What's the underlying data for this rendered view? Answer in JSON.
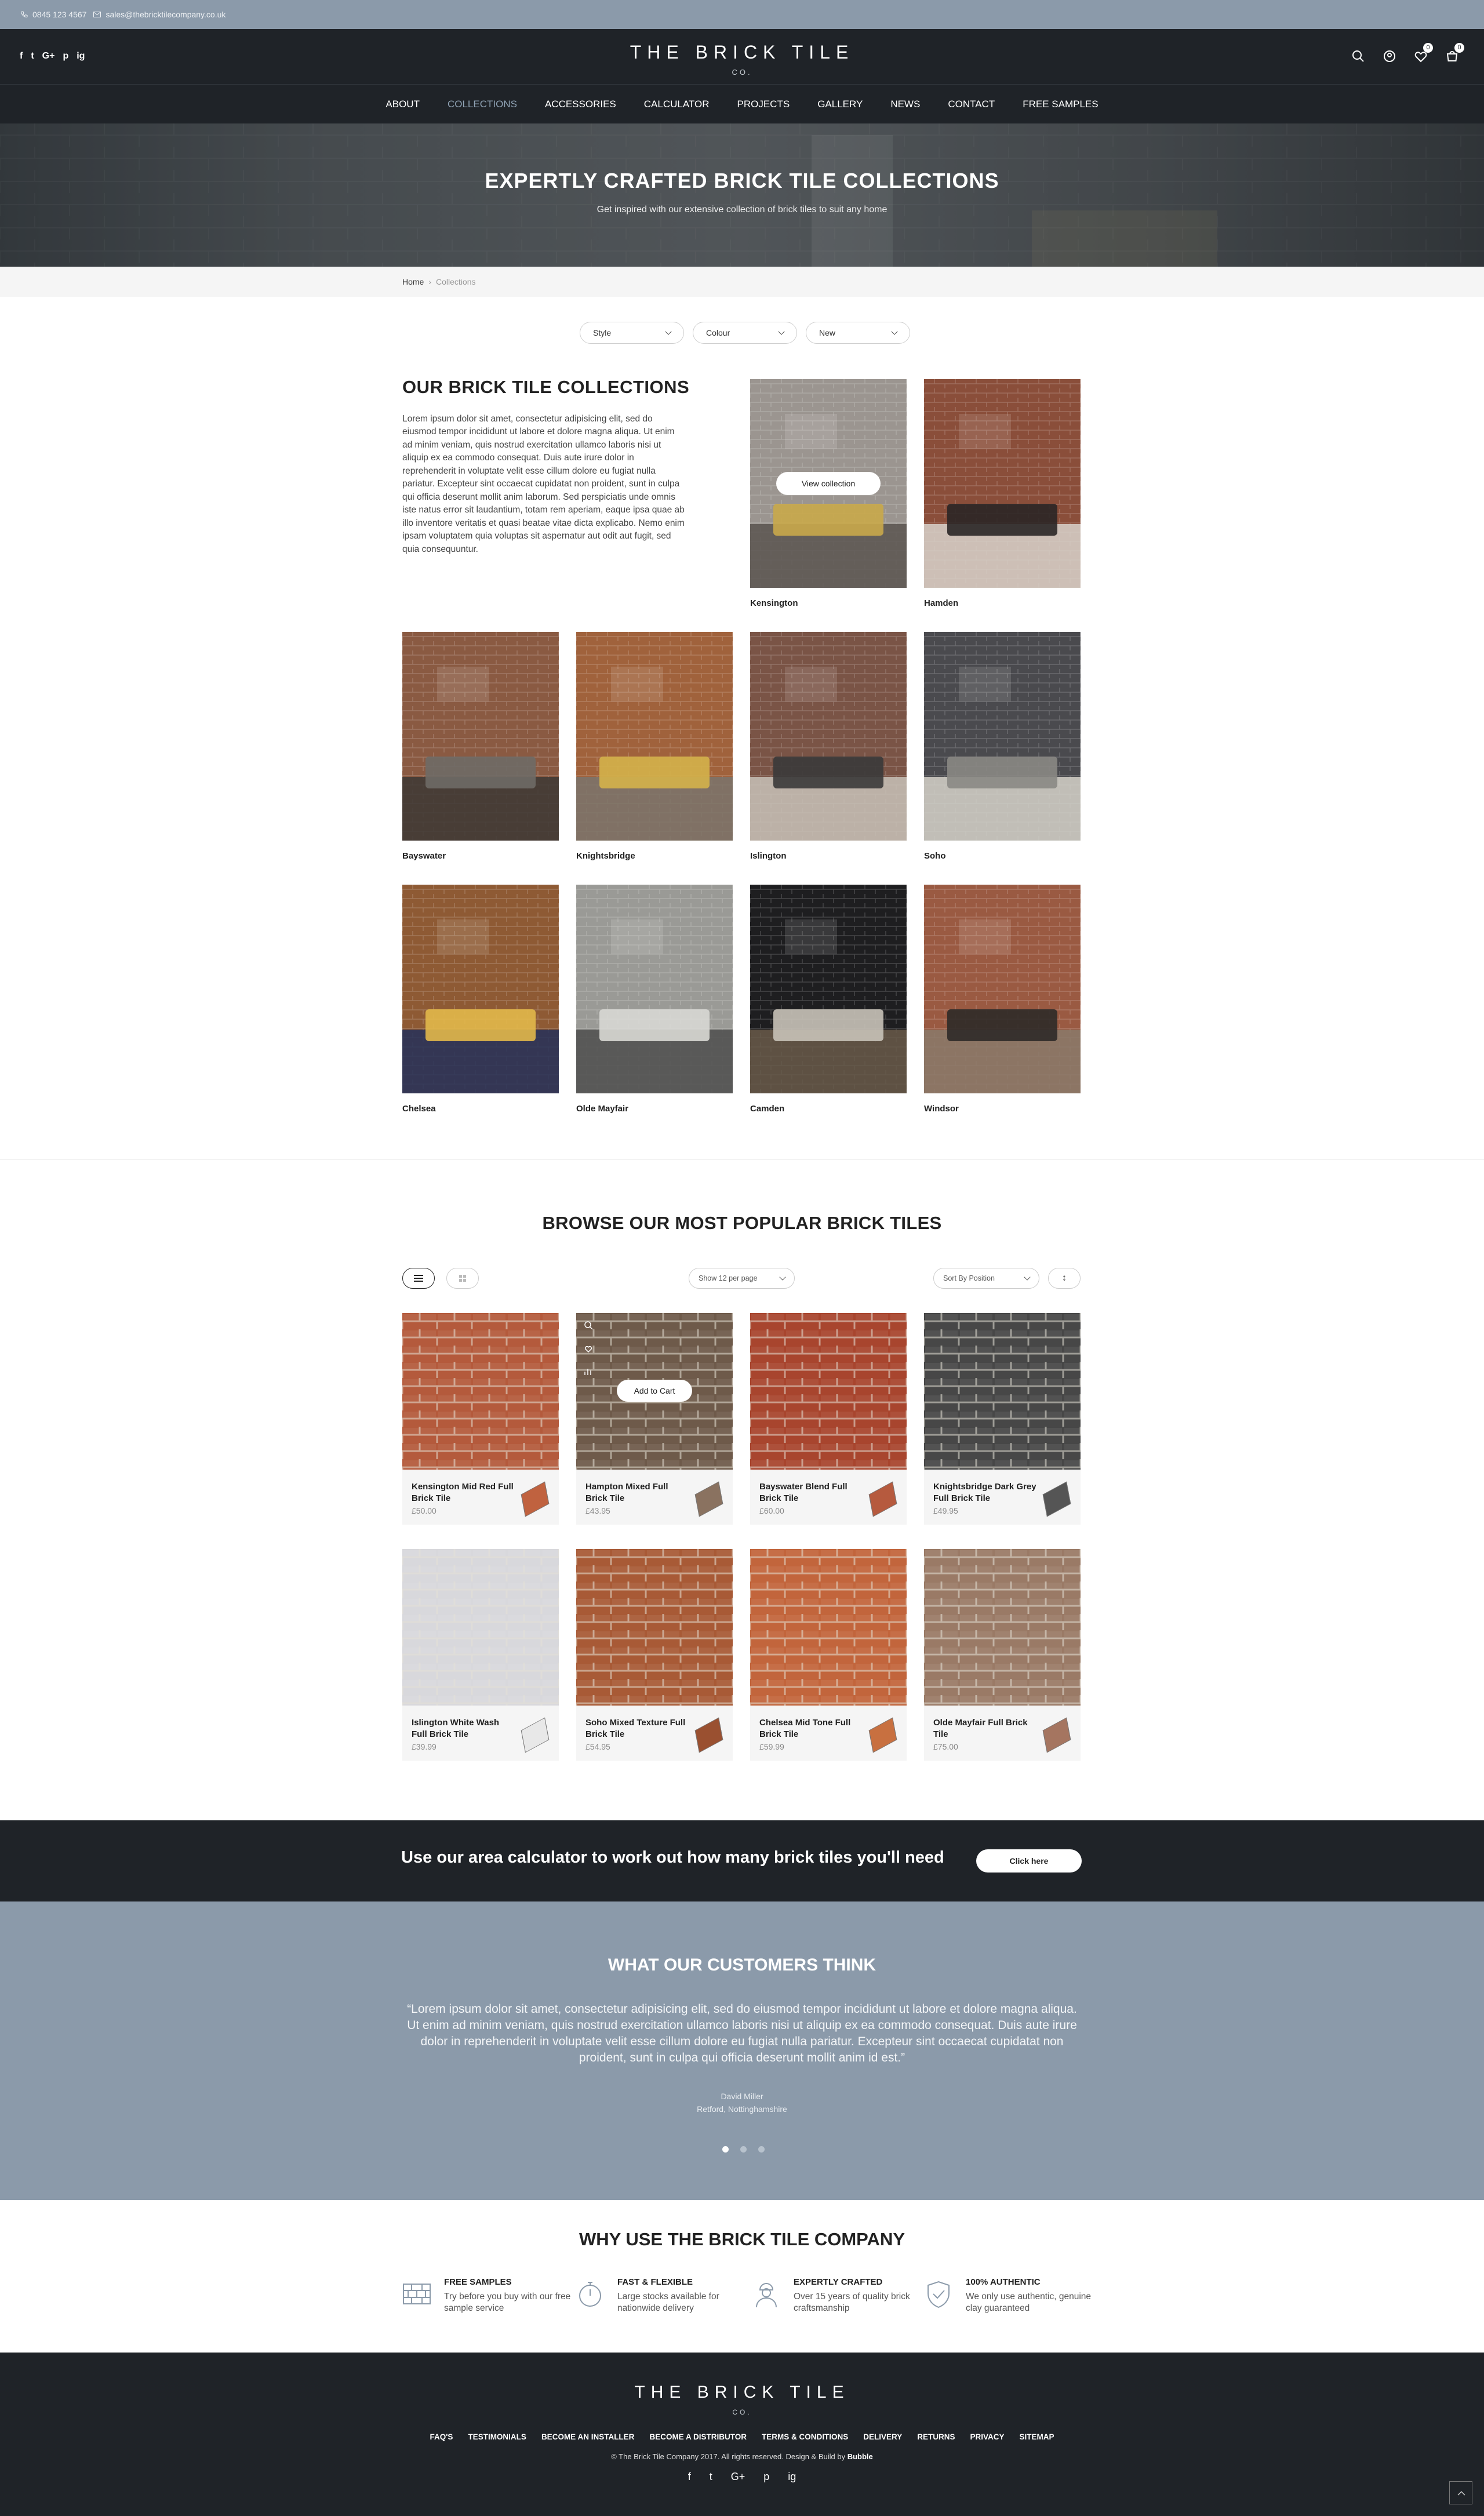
{
  "topbar": {
    "phone": "0845 123 4567",
    "email": "sales@thebricktilecompany.co.uk"
  },
  "header": {
    "logo": "THE BRICK TILE",
    "logo_sub": "CO.",
    "social": [
      "f",
      "t",
      "G+",
      "p",
      "ig"
    ],
    "wishlist_count": "0",
    "cart_count": "0"
  },
  "nav": [
    "ABOUT",
    "COLLECTIONS",
    "ACCESSORIES",
    "CALCULATOR",
    "PROJECTS",
    "GALLERY",
    "NEWS",
    "CONTACT",
    "FREE SAMPLES"
  ],
  "hero": {
    "title": "EXPERTLY CRAFTED BRICK TILE COLLECTIONS",
    "subtitle": "Get inspired with our extensive collection of brick tiles to suit any home"
  },
  "breadcrumb": {
    "home": "Home",
    "sep": "›",
    "current": "Collections"
  },
  "filters": [
    "Style",
    "Colour",
    "New"
  ],
  "intro": {
    "title": "OUR BRICK TILE COLLECTIONS",
    "text": "Lorem ipsum dolor sit amet, consectetur adipisicing elit, sed do eiusmod tempor incididunt ut labore et dolore magna aliqua. Ut enim ad minim veniam, quis nostrud exercitation ullamco laboris nisi ut aliquip ex ea commodo consequat. Duis aute irure dolor in reprehenderit in voluptate velit esse cillum dolore eu fugiat nulla pariatur. Excepteur sint occaecat cupidatat non proident, sunt in culpa qui officia deserunt mollit anim laborum. Sed perspiciatis unde omnis iste natus error sit laudantium, totam rem aperiam, eaque ipsa quae ab illo inventore veritatis et quasi beatae vitae dicta explicabo. Nemo enim ipsam voluptatem quia voluptas sit aspernatur aut odit aut fugit, sed quia consequuntur."
  },
  "view_collection": "View collection",
  "collections": [
    "Kensington",
    "Hamden",
    "Bayswater",
    "Knightsbridge",
    "Islington",
    "Soho",
    "Chelsea",
    "Olde Mayfair",
    "Camden",
    "Windsor"
  ],
  "popular": {
    "title": "BROWSE OUR MOST POPULAR BRICK TILES",
    "per_page": "Show 12 per page",
    "sort": "Sort By Position",
    "sort_dir": "↕",
    "add_to_cart": "Add to Cart",
    "products": [
      {
        "name": "Kensington Mid Red Full Brick Tile",
        "price": "£50.00",
        "color": "#b45a3c",
        "swatch": "#c0623f"
      },
      {
        "name": "Hampton Mixed Full Brick Tile",
        "price": "£43.95",
        "color": "#6e5a4a",
        "swatch": "#8a7260"
      },
      {
        "name": "Bayswater Blend Full Brick Tile",
        "price": "£60.00",
        "color": "#a8452e",
        "swatch": "#b65a3e"
      },
      {
        "name": "Knightsbridge Dark Grey Full Brick Tile",
        "price": "£49.95",
        "color": "#474747",
        "swatch": "#555"
      },
      {
        "name": "Islington White Wash Full Brick Tile",
        "price": "£39.99",
        "color": "#d8d8dc",
        "swatch": "#e8e8e8"
      },
      {
        "name": "Soho Mixed Texture Full Brick Tile",
        "price": "£54.95",
        "color": "#a85a36",
        "swatch": "#9a5030"
      },
      {
        "name": "Chelsea Mid Tone Full Brick Tile",
        "price": "£59.99",
        "color": "#c2653c",
        "swatch": "#c87040"
      },
      {
        "name": "Olde Mayfair Full Brick Tile",
        "price": "£75.00",
        "color": "#9a7a66",
        "swatch": "#a57560"
      }
    ]
  },
  "calculator": {
    "text": "Use our area calculator to work out how many brick tiles you'll need",
    "button": "Click here"
  },
  "testimonials": {
    "title": "WHAT OUR CUSTOMERS THINK",
    "quote": "“Lorem ipsum dolor sit amet, consectetur adipisicing elit, sed do eiusmod tempor incididunt ut labore et dolore magna aliqua. Ut enim ad minim veniam, quis nostrud exercitation ullamco laboris nisi ut aliquip ex ea commodo consequat. Duis aute irure dolor in reprehenderit in voluptate velit esse cillum dolore eu fugiat nulla pariatur. Excepteur sint occaecat cupidatat non proident, sunt in culpa qui officia deserunt mollit anim id est.”",
    "author": "David Miller",
    "location": "Retford, Nottinghamshire"
  },
  "why": {
    "title": "WHY USE THE BRICK TILE COMPANY",
    "features": [
      {
        "title": "FREE SAMPLES",
        "text": "Try before you buy with our free sample service",
        "icon": "brick-icon"
      },
      {
        "title": "FAST & FLEXIBLE",
        "text": "Large stocks available for nationwide delivery",
        "icon": "stopwatch-icon"
      },
      {
        "title": "EXPERTLY CRAFTED",
        "text": "Over 15 years of quality brick craftsmanship",
        "icon": "worker-icon"
      },
      {
        "title": "100% AUTHENTIC",
        "text": "We only use authentic, genuine clay guaranteed",
        "icon": "shield-check-icon"
      }
    ]
  },
  "footer": {
    "logo": "THE BRICK TILE",
    "logo_sub": "CO.",
    "links": [
      "FAQ'S",
      "TESTIMONIALS",
      "BECOME AN INSTALLER",
      "BECOME A DISTRIBUTOR",
      "TERMS & CONDITIONS",
      "DELIVERY",
      "RETURNS",
      "PRIVACY",
      "SITEMAP"
    ],
    "copyright": "© The Brick Tile Company 2017. All rights reserved. Design & Build by",
    "builder": "Bubble",
    "social": [
      "f",
      "t",
      "G+",
      "p",
      "ig"
    ]
  }
}
